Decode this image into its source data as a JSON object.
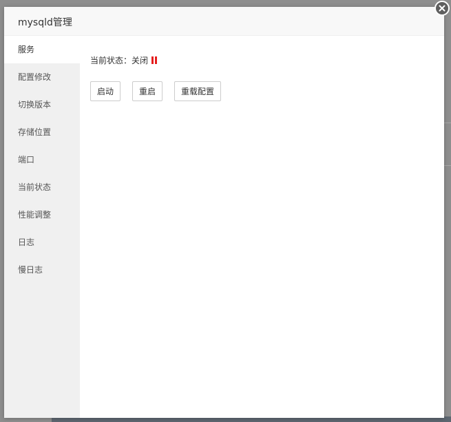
{
  "dialog": {
    "title": "mysqld管理"
  },
  "sidebar": {
    "items": [
      {
        "label": "服务",
        "active": true
      },
      {
        "label": "配置修改",
        "active": false
      },
      {
        "label": "切换版本",
        "active": false
      },
      {
        "label": "存储位置",
        "active": false
      },
      {
        "label": "端口",
        "active": false
      },
      {
        "label": "当前状态",
        "active": false
      },
      {
        "label": "性能调整",
        "active": false
      },
      {
        "label": "日志",
        "active": false
      },
      {
        "label": "慢日志",
        "active": false
      }
    ]
  },
  "service": {
    "status_label": "当前状态：",
    "status_value": "关闭",
    "status_color": "#e51d1d",
    "status_icon": "paused-indicator-icon",
    "buttons": {
      "start": "启动",
      "restart": "重启",
      "reload": "重载配置"
    }
  },
  "icons": {
    "close": "close-icon"
  }
}
